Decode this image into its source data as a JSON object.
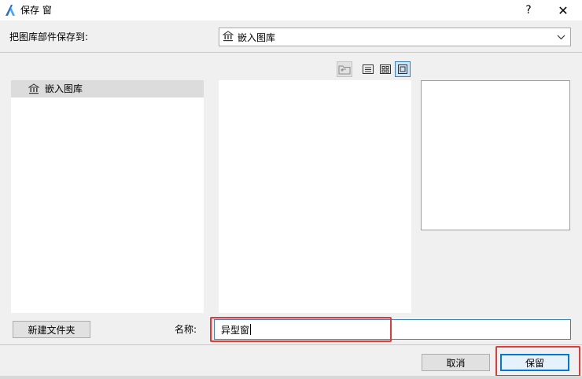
{
  "window": {
    "title": "保存 窗",
    "help_symbol": "?",
    "close_symbol": "✕"
  },
  "location": {
    "label": "把图库部件保存到:",
    "selected": "嵌入图库"
  },
  "view_buttons": [
    "folder-up-icon",
    "list-view-icon",
    "grid-view-icon",
    "large-view-icon"
  ],
  "tree": {
    "items": [
      {
        "label": "嵌入图库",
        "icon": "library-icon",
        "selected": true
      }
    ]
  },
  "actions": {
    "new_folder": "新建文件夹",
    "cancel": "取消",
    "save": "保留"
  },
  "name_field": {
    "label": "名称:",
    "value": "异型窗"
  },
  "colors": {
    "accent": "#0078d7",
    "highlight_annotation": "#e53935",
    "selection": "#dcdcdc"
  }
}
